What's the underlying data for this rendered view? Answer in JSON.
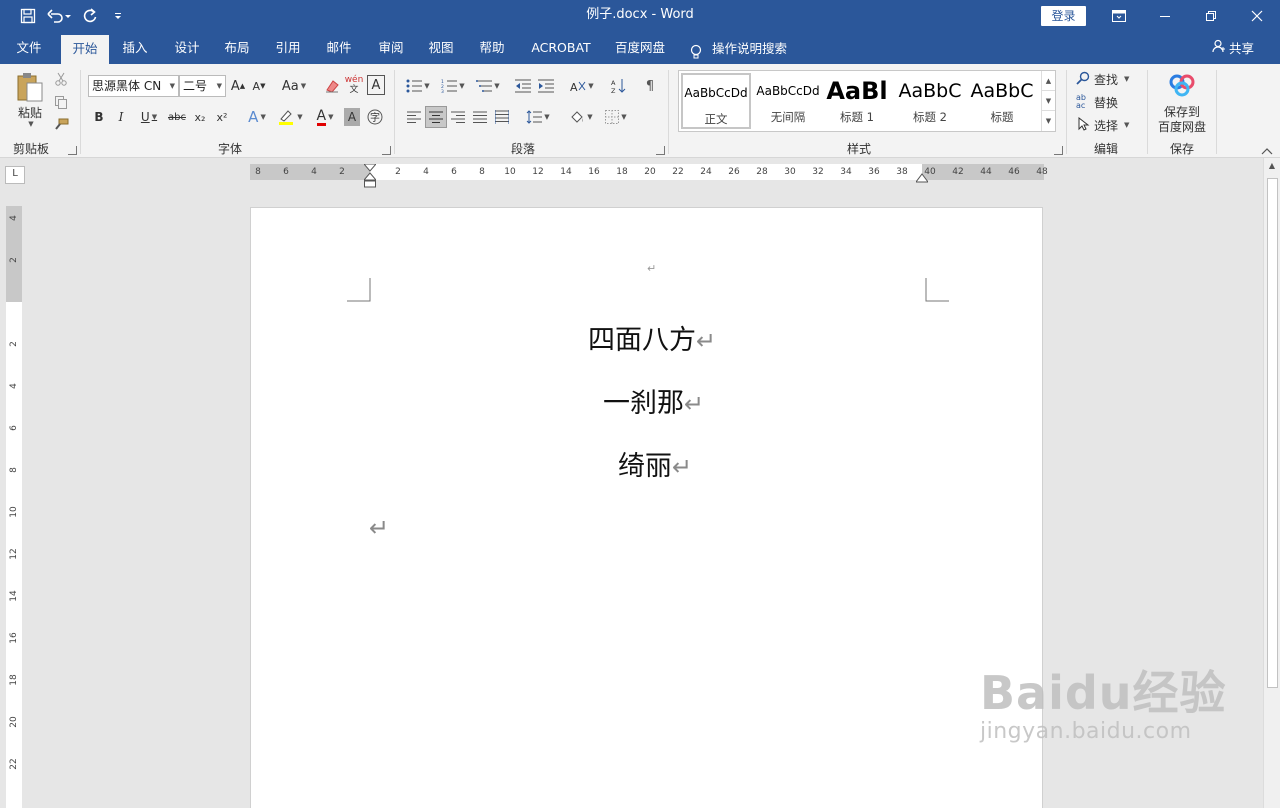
{
  "titlebar": {
    "document_title": "例子.docx  -  Word",
    "login_label": "登录",
    "colors": {
      "accent": "#2b579a"
    }
  },
  "qat": {
    "icons": [
      "save-icon",
      "undo-icon",
      "redo-icon",
      "customize-icon"
    ]
  },
  "tabs": [
    "文件",
    "开始",
    "插入",
    "设计",
    "布局",
    "引用",
    "邮件",
    "审阅",
    "视图",
    "帮助",
    "ACROBAT",
    "百度网盘",
    "操作说明搜索"
  ],
  "active_tab": "开始",
  "share_label": "共享",
  "ribbon": {
    "clipboard": {
      "paste_label": "粘贴",
      "group_label": "剪贴板"
    },
    "font": {
      "font_name": "思源黑体 CN",
      "font_size": "二号",
      "group_label": "字体",
      "change_case_label": "Aa",
      "bold": "B",
      "italic": "I",
      "underline": "U",
      "strike": "abc",
      "subscript": "x₂",
      "superscript": "x²",
      "phonetic": "wén",
      "char_border": "A"
    },
    "paragraph": {
      "group_label": "段落"
    },
    "styles": {
      "group_label": "样式",
      "items": [
        {
          "sample": "AaBbCcDd",
          "name": "正文"
        },
        {
          "sample": "AaBbCcDd",
          "name": "无间隔"
        },
        {
          "sample": "AaBl",
          "name": "标题 1"
        },
        {
          "sample": "AaBbC",
          "name": "标题 2"
        },
        {
          "sample": "AaBbC",
          "name": "标题"
        }
      ]
    },
    "editing": {
      "find": "查找",
      "replace": "替换",
      "select": "选择",
      "group_label": "编辑"
    },
    "save": {
      "line1": "保存到",
      "line2": "百度网盘",
      "group_label": "保存"
    }
  },
  "ruler": {
    "horizontal_ticks": [
      "8",
      "6",
      "4",
      "2",
      "2",
      "4",
      "6",
      "8",
      "10",
      "12",
      "14",
      "16",
      "18",
      "20",
      "22",
      "24",
      "26",
      "28",
      "30",
      "32",
      "34",
      "36",
      "38",
      "40",
      "42",
      "44",
      "46",
      "48"
    ],
    "vertical_ticks": [
      "4",
      "2",
      "2",
      "4",
      "6",
      "8",
      "10",
      "12",
      "14",
      "16",
      "18",
      "20",
      "22"
    ],
    "corner": "L"
  },
  "document": {
    "top_mark": "↵",
    "lines": [
      "四面八方",
      "一刹那",
      "绮丽"
    ],
    "paragraph_mark": "↵"
  },
  "watermark": {
    "logo": "Baidu经验",
    "url": "jingyan.baidu.com"
  }
}
